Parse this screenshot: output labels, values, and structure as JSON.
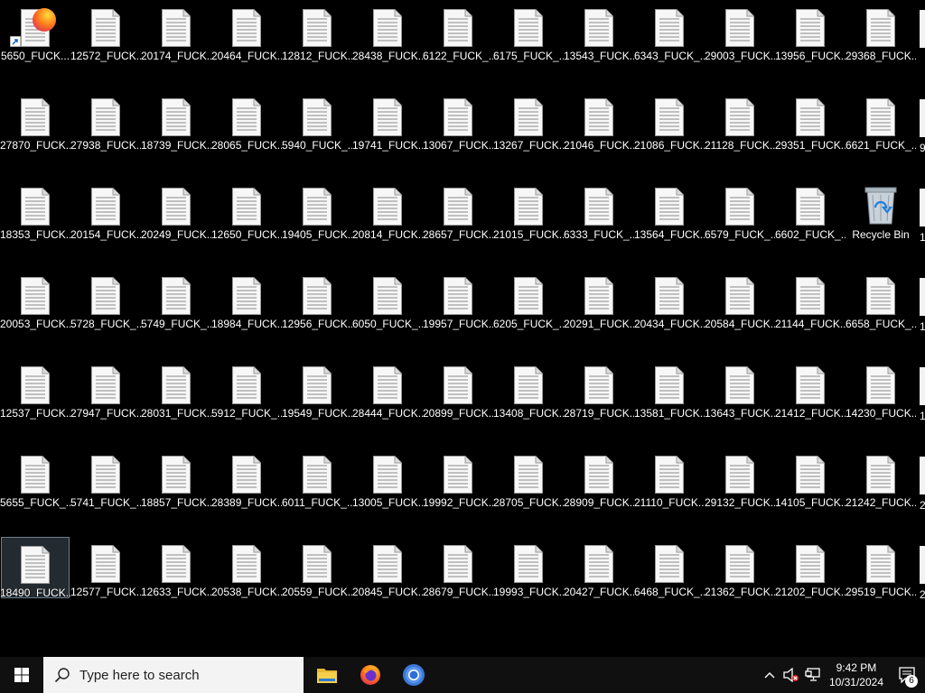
{
  "desktop": {
    "rows": [
      [
        "5650_FUCK...",
        "12572_FUCK...",
        "20174_FUCK...",
        "20464_FUCK...",
        "12812_FUCK...",
        "28438_FUCK...",
        "6122_FUCK_...",
        "6175_FUCK_...",
        "13543_FUCK...",
        "6343_FUCK_...",
        "29003_FUCK...",
        "13956_FUCK...",
        "29368_FUCK..."
      ],
      [
        "27870_FUCK...",
        "27938_FUCK...",
        "18739_FUCK...",
        "28065_FUCK...",
        "5940_FUCK_...",
        "19741_FUCK...",
        "13067_FUCK...",
        "13267_FUCK...",
        "21046_FUCK...",
        "21086_FUCK...",
        "21128_FUCK...",
        "29351_FUCK...",
        "6621_FUCK_..."
      ],
      [
        "18353_FUCK...",
        "20154_FUCK...",
        "20249_FUCK...",
        "12650_FUCK...",
        "19405_FUCK...",
        "20814_FUCK...",
        "28657_FUCK...",
        "21015_FUCK...",
        "6333_FUCK_...",
        "13564_FUCK...",
        "6579_FUCK_...",
        "6602_FUCK_...",
        "Recycle Bin"
      ],
      [
        "20053_FUCK...",
        "5728_FUCK_...",
        "5749_FUCK_...",
        "18984_FUCK...",
        "12956_FUCK...",
        "6050_FUCK_...",
        "19957_FUCK...",
        "6205_FUCK_...",
        "20291_FUCK...",
        "20434_FUCK...",
        "20584_FUCK...",
        "21144_FUCK...",
        "6658_FUCK_..."
      ],
      [
        "12537_FUCK...",
        "27947_FUCK...",
        "28031_FUCK...",
        "5912_FUCK_...",
        "19549_FUCK...",
        "28444_FUCK...",
        "20899_FUCK...",
        "13408_FUCK...",
        "28719_FUCK...",
        "13581_FUCK...",
        "13643_FUCK...",
        "21412_FUCK...",
        "14230_FUCK..."
      ],
      [
        "5655_FUCK_...",
        "5741_FUCK_...",
        "18857_FUCK...",
        "28389_FUCK...",
        "6011_FUCK_...",
        "13005_FUCK...",
        "19992_FUCK...",
        "28705_FUCK...",
        "28909_FUCK...",
        "21110_FUCK...",
        "29132_FUCK...",
        "14105_FUCK...",
        "21242_FUCK..."
      ],
      [
        "18490_FUCK...",
        "12577_FUCK...",
        "12633_FUCK...",
        "20538_FUCK...",
        "20559_FUCK...",
        "20845_FUCK...",
        "28679_FUCK...",
        "19993_FUCK...",
        "20427_FUCK...",
        "6468_FUCK_...",
        "21362_FUCK...",
        "21202_FUCK...",
        "29519_FUCK..."
      ]
    ],
    "partial_column": [
      "",
      "9",
      "1",
      "1",
      "1",
      "2",
      "2"
    ],
    "selected": {
      "row": 6,
      "col": 0
    },
    "special": {
      "recycle_bin": {
        "row": 2,
        "col": 12
      },
      "shortcut_overlay": {
        "row": 0,
        "col": 0
      }
    }
  },
  "taskbar": {
    "search_placeholder": "Type here to search",
    "apps": [
      "file-explorer",
      "firefox",
      "chrome"
    ],
    "clock_time": "9:42 PM",
    "clock_date": "10/31/2024",
    "notification_count": "6"
  }
}
